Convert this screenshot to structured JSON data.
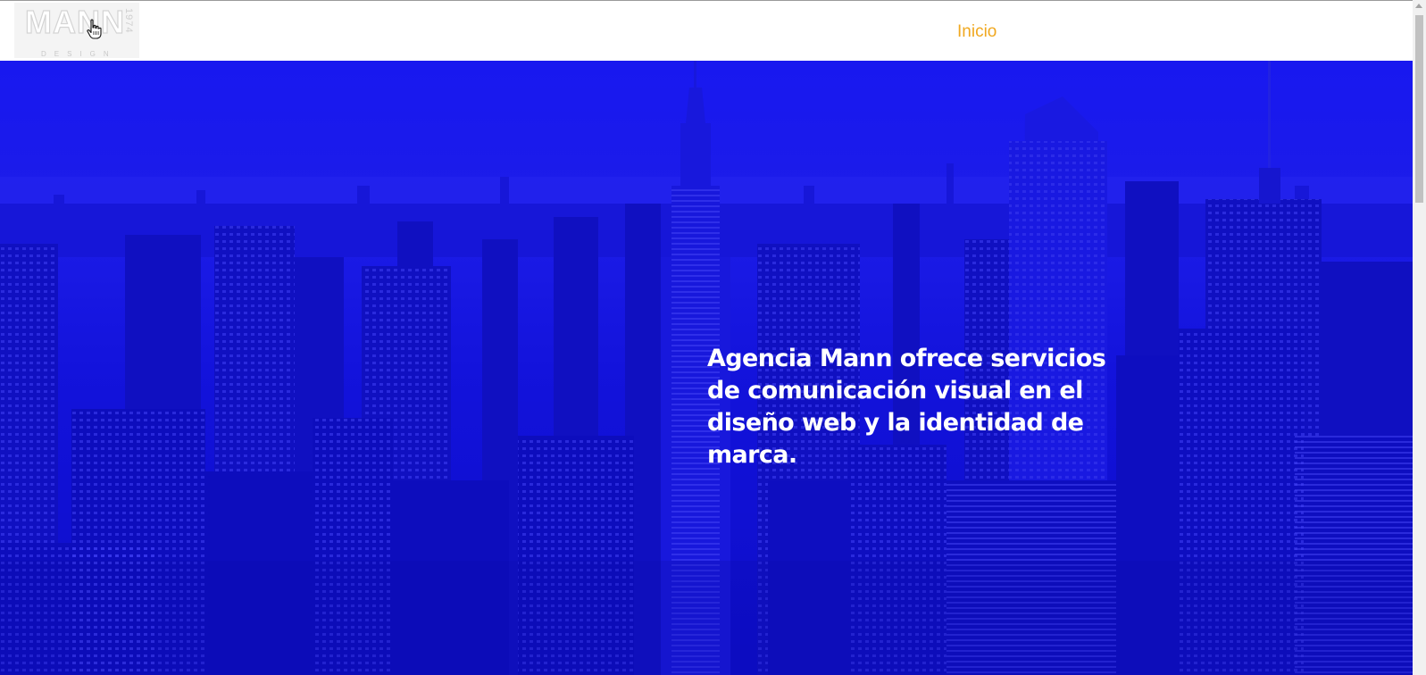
{
  "header": {
    "logo": {
      "word": "MANN",
      "year": "1974",
      "sub": "DESIGN"
    },
    "nav": {
      "home_label": "Inicio"
    }
  },
  "hero": {
    "headline": "Agencia Mann ofrece servicios de comunicación visual en el diseño web y la identidad de marca."
  },
  "colors": {
    "accent": "#f0a820",
    "hero_blue": "#1414e6"
  },
  "icons": {
    "cursor": "hand-pointer-icon"
  }
}
